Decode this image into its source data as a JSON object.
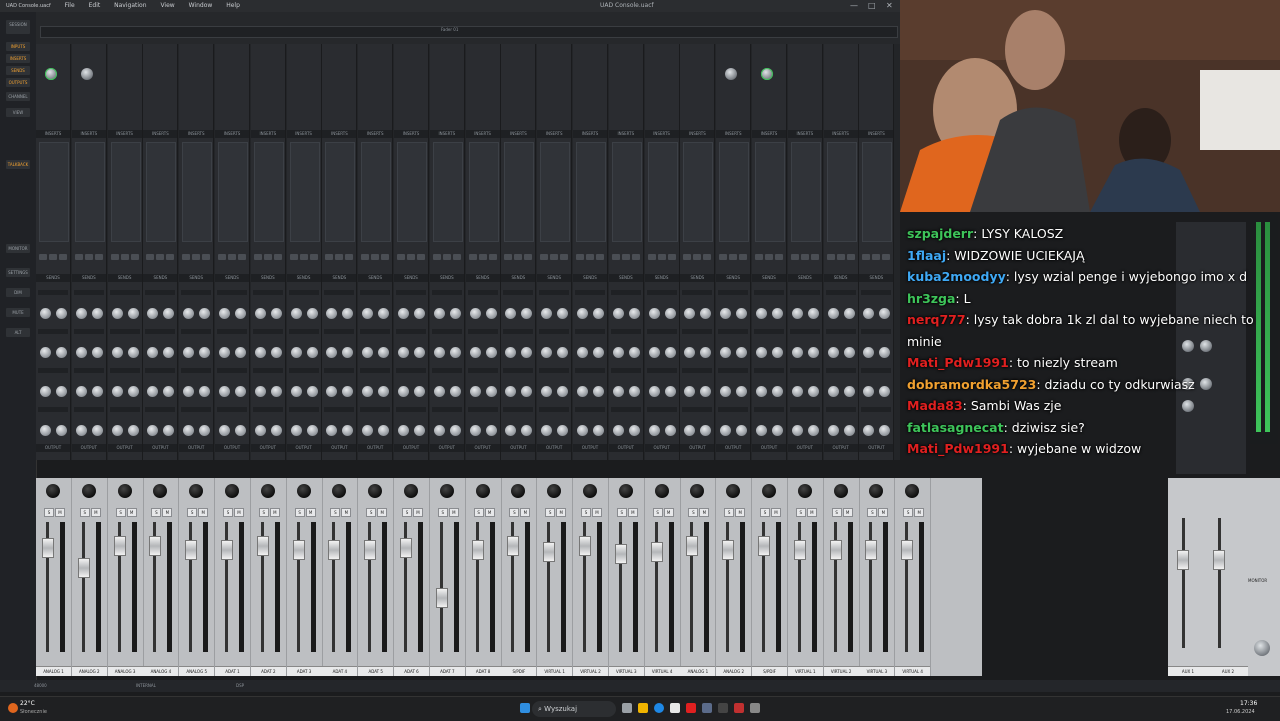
{
  "window": {
    "title": "UAD Console.uacf",
    "menu": [
      "File",
      "Edit",
      "Navigation",
      "View",
      "Window",
      "Help"
    ],
    "session_label": "SESSION",
    "timeline_label": "Fader 01"
  },
  "leftnav": {
    "items": [
      "INPUTS",
      "INSERTS",
      "SENDS",
      "OUTPUTS",
      "CHANNEL",
      "VIEW",
      "TALKBACK",
      "MONITOR",
      "SETTINGS",
      "DIM",
      "MUTE",
      "ALT"
    ]
  },
  "section_labels": {
    "inserts": "INSERTS",
    "sends": "SENDS",
    "output": "OUTPUT",
    "monitor": "MONITOR"
  },
  "channels": [
    "ANALOG 1",
    "ANALOG 2",
    "ANALOG 3",
    "ANALOG 4",
    "ANALOG 5",
    "ADAT 1",
    "ADAT 2",
    "ADAT 3",
    "ADAT 4",
    "ADAT 5",
    "ADAT 6",
    "ADAT 7",
    "ADAT 8",
    "S/PDIF",
    "VIRTUAL 1",
    "VIRTUAL 2",
    "VIRTUAL 3",
    "VIRTUAL 4",
    "ANALOG 1",
    "ANALOG 2",
    "S/PDIF",
    "VIRTUAL 1",
    "VIRTUAL 2",
    "VIRTUAL 3",
    "VIRTUAL 4"
  ],
  "right_panel": {
    "aux1": "AUX 1",
    "aux2": "AUX 2",
    "monitor": "MONITOR"
  },
  "chat": [
    {
      "user": "szpajderr",
      "color": "#3ec45a",
      "message": ": LYSY KALOSZ"
    },
    {
      "user": "1flaaj",
      "color": "#3fa9f5",
      "message": ": WIDZOWIE UCIEKAJĄ"
    },
    {
      "user": "kuba2moodyy",
      "color": "#3fa9f5",
      "message": ": lysy wzial penge i wyjebongo imo x d"
    },
    {
      "user": "hr3zga",
      "color": "#3ec45a",
      "message": ": L"
    },
    {
      "user": "nerq777",
      "color": "#e02020",
      "message": ": lysy tak dobra 1k zl dal to wyjebane niech to"
    },
    {
      "user": "",
      "color": "#ffffff",
      "message": "minie"
    },
    {
      "user": "Mati_Pdw1991",
      "color": "#e02020",
      "message": ": to niezly stream"
    },
    {
      "user": "dobramordka5723",
      "color": "#f0a030",
      "message": ": dziadu co ty odkurwiasz"
    },
    {
      "user": "Mada83",
      "color": "#e02020",
      "message": ": Sambi Was zje"
    },
    {
      "user": "fatlasagnecat",
      "color": "#3ec45a",
      "message": ": dziwisz sie?"
    },
    {
      "user": "Mati_Pdw1991",
      "color": "#e02020",
      "message": ": wyjebane w widzow"
    }
  ],
  "statusbar": {
    "rate": "48000",
    "clock": "INTERNAL",
    "text": "DSP"
  },
  "taskbar": {
    "search_placeholder": "Wyszukaj",
    "time": "17:36",
    "date": "17.06.2024",
    "weather_temp": "22°C",
    "weather_text": "Słonecznie"
  }
}
